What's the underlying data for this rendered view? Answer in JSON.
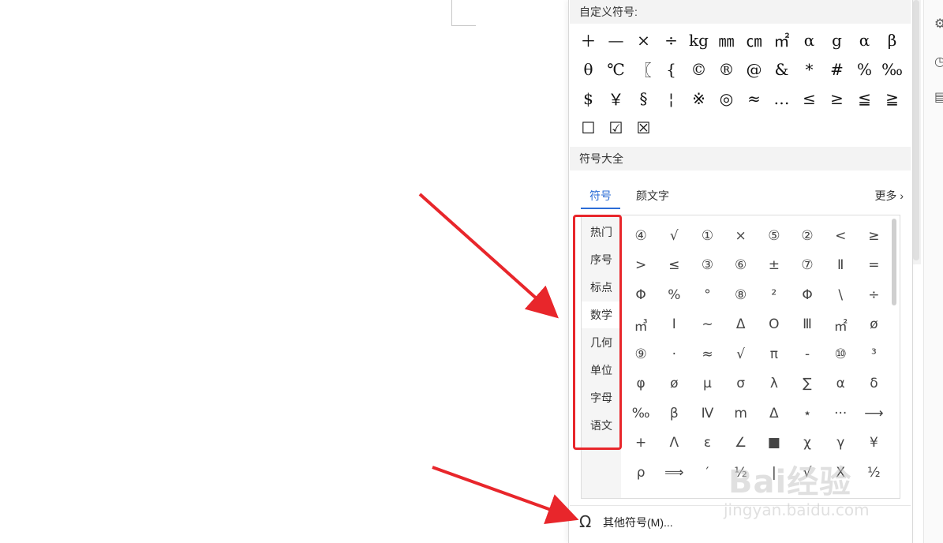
{
  "panel": {
    "custom_header": "自定义符号:",
    "custom_symbols": [
      "＋",
      "—",
      "×",
      "÷",
      "kg",
      "㎜",
      "㎝",
      "㎡",
      "α",
      "g",
      "α",
      "β",
      "θ",
      "℃",
      "〖",
      "{",
      "©",
      "®",
      "@",
      "&",
      "*",
      "#",
      "%",
      "‰",
      "$",
      "￥",
      "§",
      "¦",
      "※",
      "◎",
      "≈",
      "…",
      "≤",
      "≥",
      "≦",
      "≧",
      "☐",
      "☑",
      "☒"
    ],
    "all_header": "符号大全",
    "tabs": [
      "符号",
      "颜文字"
    ],
    "more_label": "更多",
    "categories": [
      "热门",
      "序号",
      "标点",
      "数学",
      "几何",
      "单位",
      "字母",
      "语文"
    ],
    "active_category": "数学",
    "symbols": [
      "④",
      "√",
      "①",
      "×",
      "⑤",
      "②",
      "<",
      "≥",
      ">",
      "≤",
      "③",
      "⑥",
      "±",
      "⑦",
      "Ⅱ",
      "=",
      "Φ",
      "%",
      "°",
      "⑧",
      "²",
      "Φ",
      "\\",
      "÷",
      "㎥",
      "Ⅰ",
      "~",
      "Δ",
      "Ο",
      "Ⅲ",
      "㎡",
      "ø",
      "⑨",
      "·",
      "≈",
      "√",
      "π",
      "-",
      "⑩",
      "³",
      "φ",
      "ø",
      "μ",
      "σ",
      "λ",
      "∑",
      "α",
      "δ",
      "‰",
      "β",
      "Ⅳ",
      "m",
      "Δ",
      "⋆",
      "···",
      "⟶",
      "+",
      "Λ",
      "ε",
      "∠",
      "■",
      "χ",
      "γ",
      "¥",
      "ρ",
      "⟹",
      "′",
      "½",
      "|",
      "√",
      "X",
      "½"
    ],
    "footer_label": "其他符号(M)..."
  },
  "watermark": {
    "brand": "Bai经验",
    "url": "jingyan.baidu.com"
  },
  "colors": {
    "accent": "#2b6cd6",
    "highlight": "#e8262b"
  }
}
